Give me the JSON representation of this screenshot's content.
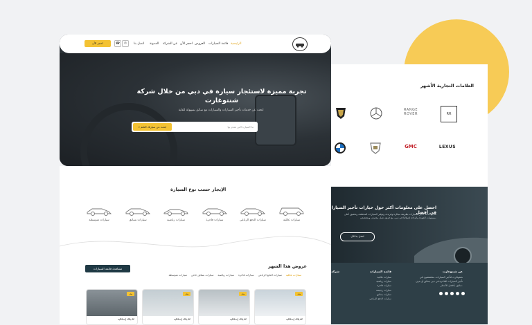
{
  "nav": {
    "links": [
      "الرئيسية",
      "قائمة السيارات",
      "العروض",
      "احجز الآن",
      "عن الشركة",
      "المدونة",
      "اتصل بنا"
    ],
    "cta": "احجز الآن",
    "phone_icon": "phone-icon",
    "whatsapp_icon": "whatsapp-icon"
  },
  "hero": {
    "title": "تجربة مميزة لاستئجار سيارة في دبي من خلال شركة شنتوغارت",
    "subtitle": "ابحث عن خدمات تأجير السيارات والسيارات مع سائق بسهولة للغاية",
    "search_placeholder": "ما السيارة التي تقدم بها",
    "search_button": "ابحث عن سيارتك الحلم"
  },
  "brands": {
    "title": "العلامات التجارية الأشهر",
    "items": [
      "RANGE ROVER",
      "GMC",
      "LEXUS"
    ]
  },
  "car_types": {
    "title": "الإيجار حسب نوع السيارة",
    "items": [
      "سيارات عائلية",
      "سيارات الدفع الرباعي",
      "سيارات فاخرة",
      "سيارات رياضية",
      "سيارات بسائق",
      "سيارات متوسطة"
    ]
  },
  "offers": {
    "title": "عروض هذا الشهر",
    "view_all": "مشاهدة قائمة السيارات",
    "tabs": [
      "سيارات عائلية",
      "سيارات الدفع الرباعي",
      "سيارات فاخرة",
      "سيارات رياضية",
      "سيارات بسائق خاص",
      "سيارات متوسطة"
    ],
    "cards": [
      {
        "badge": "وفر",
        "name": "كاديلاك إسكاليد"
      },
      {
        "badge": "وفر",
        "name": "كاديلاك إسكاليد"
      },
      {
        "badge": "وفر",
        "name": "كاديلاك إسكاليد"
      },
      {
        "badge": "وفر",
        "name": "كاديلاك إسكاليد"
      }
    ]
  },
  "info": {
    "title": "احصل على معلومات أكثر حول خيارات تأجير السيارات في أفضل",
    "text": "تقديم خدمة تأجير السيارات بطريقة مبتكرة وفريدة، وتوفير السيارات المختلفة، وتحقيق أعلى مستويات الجودة والراحة لعملائنا في دبي، مع فريق عمل محترف ومتخصص.",
    "button": "اتصل بنا الآن"
  },
  "footer": {
    "about_title": "عن شنتوغارت",
    "about_text": "شنتوغارت لتأجير السيارات، متخصصون في تأجير السيارات الفاخرة في دبي بسائق أو بدون سائق، بأفضل الأسعار.",
    "list_title": "قائمة السيارات",
    "list_items": [
      "سيارات عائلية",
      "سيارات رياضية",
      "سيارات فاخرة",
      "سيارات رخيصة",
      "سيارات بسائق",
      "سيارات الدفع الرباعي"
    ],
    "third_title": "شركة"
  },
  "colors": {
    "accent": "#f3c233",
    "dark": "#1f3944",
    "circle": "#f7cb56"
  }
}
